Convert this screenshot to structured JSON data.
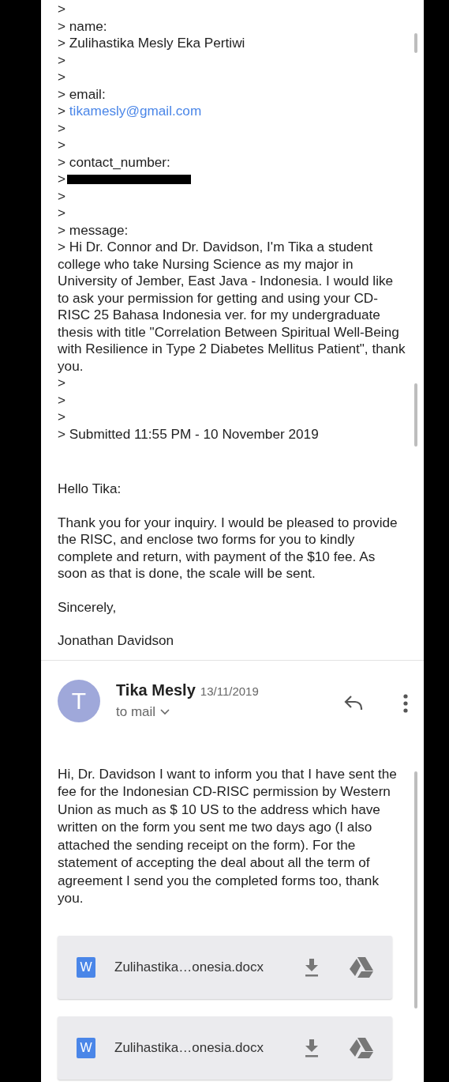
{
  "quoted_lines": [
    {
      "kind": "text",
      "text": ">"
    },
    {
      "kind": "text",
      "text": "> name:"
    },
    {
      "kind": "text",
      "text": "> Zulihastika Mesly Eka Pertiwi"
    },
    {
      "kind": "text",
      "text": ">"
    },
    {
      "kind": "text",
      "text": ">"
    },
    {
      "kind": "text",
      "text": "> email:"
    },
    {
      "kind": "link",
      "prefix": ">",
      "text": "tikamesly@gmail.com"
    },
    {
      "kind": "text",
      "text": ">"
    },
    {
      "kind": "text",
      "text": ">"
    },
    {
      "kind": "text",
      "text": "> contact_number:"
    },
    {
      "kind": "redacted",
      "prefix": ">"
    },
    {
      "kind": "text",
      "text": ">"
    },
    {
      "kind": "text",
      "text": ">"
    },
    {
      "kind": "text",
      "text": "> message:"
    },
    {
      "kind": "text",
      "text": "> Hi Dr. Connor and Dr. Davidson, I'm Tika a student college who take Nursing Science as my major in University of Jember, East Java - Indonesia. I would like to ask your permission for getting and using your CD-RISC 25 Bahasa Indonesia ver. for my undergraduate thesis with title \"Correlation Between Spiritual Well-Being with Resilience in Type 2 Diabetes Mellitus Patient\", thank you."
    },
    {
      "kind": "text",
      "text": ">"
    },
    {
      "kind": "text",
      "text": ">"
    },
    {
      "kind": "text",
      "text": ">"
    },
    {
      "kind": "text",
      "text": "> Submitted 11:55 PM - 10 November 2019"
    }
  ],
  "reply": {
    "paragraphs": [
      "Hello Tika:",
      "Thank you for your inquiry. I would be pleased to provide the RISC, and enclose two forms for you to kindly complete and return, with payment of the $10 fee. As soon as that is done, the scale will be sent.",
      "Sincerely,",
      "Jonathan Davidson"
    ]
  },
  "message": {
    "avatar_letter": "T",
    "sender": "Tika Mesly",
    "date": "13/11/2019",
    "recipient": "to mail",
    "body": "Hi, Dr. Davidson I want to inform you that I have sent the fee for the Indonesian CD-RISC permission by Western Union as much as $ 10 US to the address which have written on the form you sent me two days ago (I also attached the sending receipt on the form). For the statement of accepting the deal about all the term of agreement I send you the completed forms too, thank you.",
    "attachments": [
      {
        "type_label": "W",
        "file_name": "Zulihastika…onesia.docx"
      },
      {
        "type_label": "W",
        "file_name": "Zulihastika…onesia.docx"
      }
    ]
  }
}
